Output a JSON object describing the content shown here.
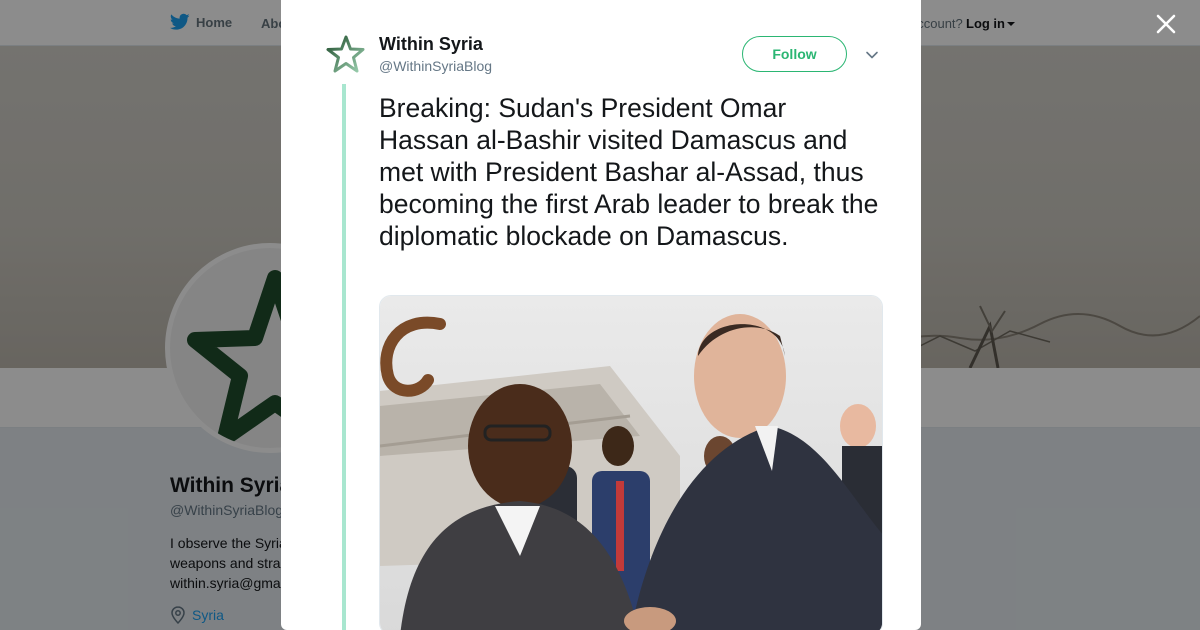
{
  "topnav": {
    "home_label": "Home",
    "about_label": "Abo",
    "account_text": "account?",
    "login_label": "Log in"
  },
  "profile": {
    "name": "Within Syria",
    "handle": "@WithinSyriaBlog",
    "bio_lines": [
      "I observe the Syria",
      "weapons and stra",
      "within.syria@gma"
    ],
    "location": "Syria"
  },
  "tweet": {
    "author_name": "Within Syria",
    "author_handle": "@WithinSyriaBlog",
    "follow_label": "Follow",
    "text": "Breaking: Sudan's President Omar Hassan al-Bashir visited Damascus and met with President Bashar al-Assad, thus becoming the first Arab leader to break the diplomatic blockade on Damascus."
  },
  "icons": {
    "bird": "twitter-bird-icon",
    "close": "close-icon",
    "chevron": "chevron-down-icon",
    "location": "location-pin-icon",
    "avatar": "star-logo-icon"
  },
  "colors": {
    "accent_green": "#2bb673",
    "twitter_blue": "#1da1f2",
    "thread_line": "#a8e6cf",
    "text": "#14171a",
    "muted": "#657786"
  }
}
